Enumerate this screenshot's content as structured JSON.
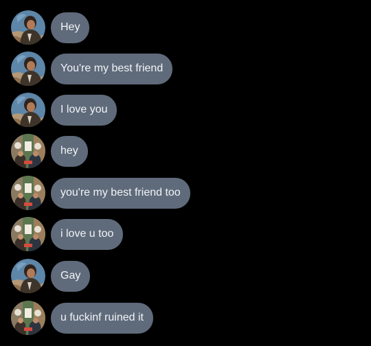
{
  "colors": {
    "background": "#000000",
    "bubble": "#5f6b7b",
    "bubble_text": "#f2f4f7"
  },
  "messages": [
    {
      "text": "Hey",
      "avatar": "avatar-a"
    },
    {
      "text": "You're my best friend",
      "avatar": "avatar-a"
    },
    {
      "text": "I love you",
      "avatar": "avatar-a"
    },
    {
      "text": "hey",
      "avatar": "avatar-b"
    },
    {
      "text": "you're my best friend too",
      "avatar": "avatar-b"
    },
    {
      "text": "i love u too",
      "avatar": "avatar-b"
    },
    {
      "text": "Gay",
      "avatar": "avatar-a"
    },
    {
      "text": "u fuckinf ruined it",
      "avatar": "avatar-b"
    }
  ]
}
